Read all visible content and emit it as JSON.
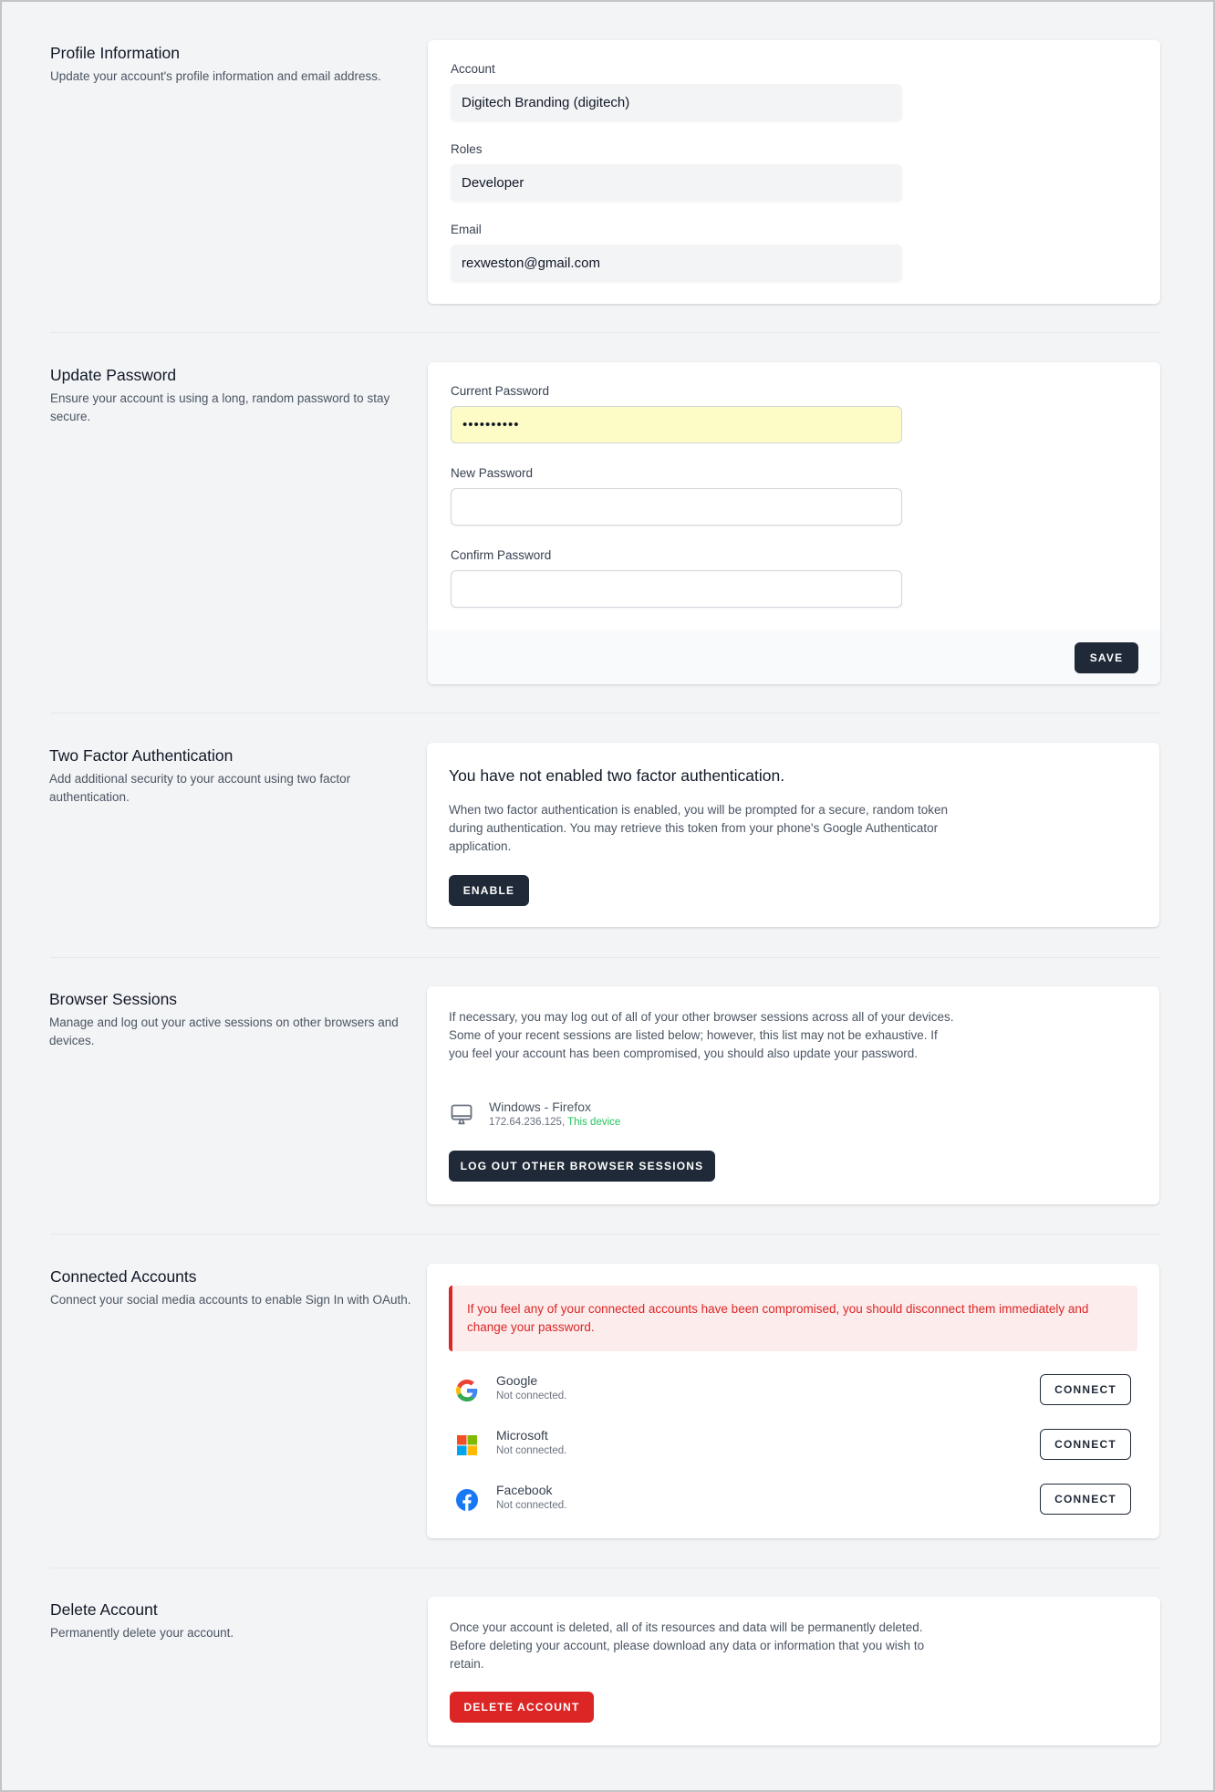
{
  "profile": {
    "title": "Profile Information",
    "description": "Update your account's profile information and email address.",
    "fields": [
      {
        "label": "Account",
        "value": "Digitech Branding (digitech)"
      },
      {
        "label": "Roles",
        "value": "Developer"
      },
      {
        "label": "Email",
        "value": "rexweston@gmail.com"
      }
    ]
  },
  "password": {
    "title": "Update Password",
    "description": "Ensure your account is using a long, random password to stay secure.",
    "current_label": "Current Password",
    "current_value": "••••••••••",
    "new_label": "New Password",
    "new_value": "",
    "confirm_label": "Confirm Password",
    "confirm_value": "",
    "save_label": "SAVE"
  },
  "two_factor": {
    "title": "Two Factor Authentication",
    "description": "Add additional security to your account using two factor authentication.",
    "heading": "You have not enabled two factor authentication.",
    "body": "When two factor authentication is enabled, you will be prompted for a secure, random token during authentication. You may retrieve this token from your phone's Google Authenticator application.",
    "enable_label": "ENABLE"
  },
  "sessions": {
    "title": "Browser Sessions",
    "description": "Manage and log out your active sessions on other browsers and devices.",
    "body": "If necessary, you may log out of all of your other browser sessions across all of your devices. Some of your recent sessions are listed below; however, this list may not be exhaustive. If you feel your account has been compromised, you should also update your password.",
    "items": [
      {
        "icon": "desktop-icon",
        "device": "Windows - Firefox",
        "ip": "172.64.236.125,",
        "current": "This device"
      }
    ],
    "logout_label": "LOG OUT OTHER BROWSER SESSIONS",
    "current_color": "#22c55e"
  },
  "connected": {
    "title": "Connected Accounts",
    "description": "Connect your social media accounts to enable Sign In with OAuth.",
    "alert": "If you feel any of your connected accounts have been compromised, you should disconnect them immediately and change your password.",
    "accounts": [
      {
        "name": "Google",
        "status": "Not connected.",
        "icon": "google-icon",
        "action": "CONNECT"
      },
      {
        "name": "Microsoft",
        "status": "Not connected.",
        "icon": "microsoft-icon",
        "action": "CONNECT"
      },
      {
        "name": "Facebook",
        "status": "Not connected.",
        "icon": "facebook-icon",
        "action": "CONNECT"
      }
    ]
  },
  "delete": {
    "title": "Delete Account",
    "description": "Permanently delete your account.",
    "body": "Once your account is deleted, all of its resources and data will be permanently deleted. Before deleting your account, please download any data or information that you wish to retain.",
    "button_label": "DELETE ACCOUNT",
    "color": "#dc2626"
  },
  "colors": {
    "primary_button": "#1f2937",
    "danger": "#dc2626",
    "background": "#f3f4f6"
  }
}
